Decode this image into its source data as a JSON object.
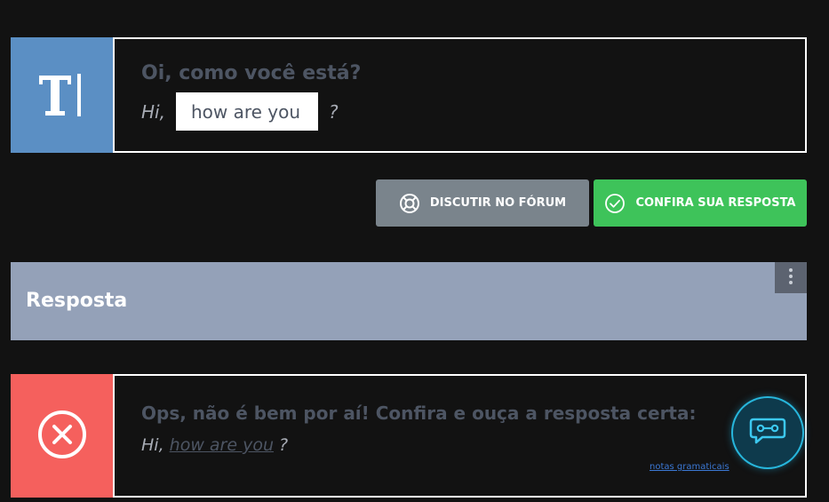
{
  "exercise": {
    "icon": "text-cursor-icon",
    "prompt": "Oi, como você está?",
    "sentence_prefix": "Hi,",
    "answer_value": "how are you",
    "sentence_suffix": "?"
  },
  "actions": {
    "forum_label": "DISCUTIR NO FÓRUM",
    "forum_icon": "lifebuoy-icon",
    "check_label": "CONFIRA SUA RESPOSTA",
    "check_icon": "check-circle-icon"
  },
  "answer_section": {
    "title": "Resposta",
    "menu_icon": "kebab-menu-icon"
  },
  "feedback": {
    "icon": "error-x-circle-icon",
    "message": "Ops, não é bem por aí! Confira e ouça a resposta certa:",
    "sentence_prefix": "Hi,",
    "correct_answer": "how are you",
    "sentence_suffix": "?",
    "grammar_link": "notas gramaticais"
  },
  "assistant": {
    "icon": "chat-bot-icon"
  },
  "colors": {
    "background": "#121212",
    "exercise_accent": "#5b8fc4",
    "forum_button": "#7a848c",
    "check_button": "#3ec35a",
    "answer_header": "#94a1b8",
    "error_accent": "#f5605d",
    "assistant_glow": "#27b6dc"
  }
}
